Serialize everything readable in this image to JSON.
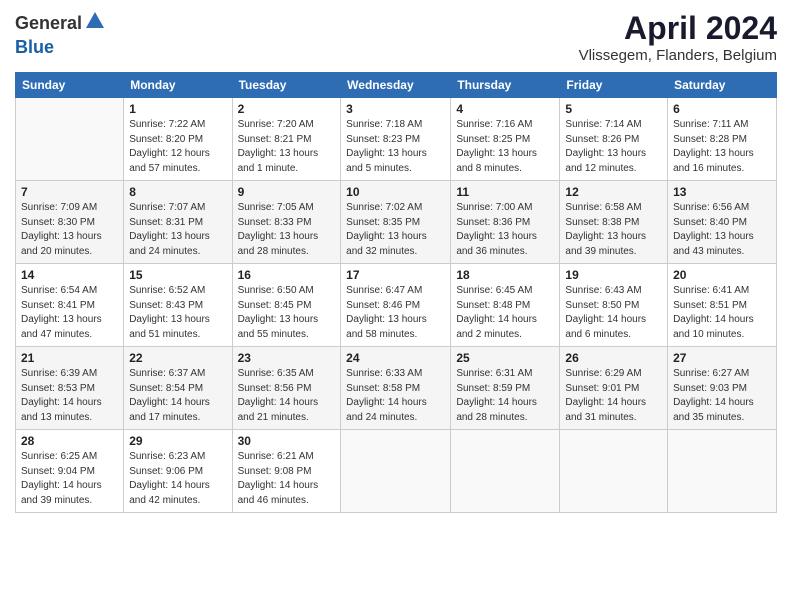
{
  "logo": {
    "general": "General",
    "blue": "Blue"
  },
  "title": "April 2024",
  "location": "Vlissegem, Flanders, Belgium",
  "days_header": [
    "Sunday",
    "Monday",
    "Tuesday",
    "Wednesday",
    "Thursday",
    "Friday",
    "Saturday"
  ],
  "weeks": [
    [
      {
        "num": "",
        "info": ""
      },
      {
        "num": "1",
        "info": "Sunrise: 7:22 AM\nSunset: 8:20 PM\nDaylight: 12 hours\nand 57 minutes."
      },
      {
        "num": "2",
        "info": "Sunrise: 7:20 AM\nSunset: 8:21 PM\nDaylight: 13 hours\nand 1 minute."
      },
      {
        "num": "3",
        "info": "Sunrise: 7:18 AM\nSunset: 8:23 PM\nDaylight: 13 hours\nand 5 minutes."
      },
      {
        "num": "4",
        "info": "Sunrise: 7:16 AM\nSunset: 8:25 PM\nDaylight: 13 hours\nand 8 minutes."
      },
      {
        "num": "5",
        "info": "Sunrise: 7:14 AM\nSunset: 8:26 PM\nDaylight: 13 hours\nand 12 minutes."
      },
      {
        "num": "6",
        "info": "Sunrise: 7:11 AM\nSunset: 8:28 PM\nDaylight: 13 hours\nand 16 minutes."
      }
    ],
    [
      {
        "num": "7",
        "info": "Sunrise: 7:09 AM\nSunset: 8:30 PM\nDaylight: 13 hours\nand 20 minutes."
      },
      {
        "num": "8",
        "info": "Sunrise: 7:07 AM\nSunset: 8:31 PM\nDaylight: 13 hours\nand 24 minutes."
      },
      {
        "num": "9",
        "info": "Sunrise: 7:05 AM\nSunset: 8:33 PM\nDaylight: 13 hours\nand 28 minutes."
      },
      {
        "num": "10",
        "info": "Sunrise: 7:02 AM\nSunset: 8:35 PM\nDaylight: 13 hours\nand 32 minutes."
      },
      {
        "num": "11",
        "info": "Sunrise: 7:00 AM\nSunset: 8:36 PM\nDaylight: 13 hours\nand 36 minutes."
      },
      {
        "num": "12",
        "info": "Sunrise: 6:58 AM\nSunset: 8:38 PM\nDaylight: 13 hours\nand 39 minutes."
      },
      {
        "num": "13",
        "info": "Sunrise: 6:56 AM\nSunset: 8:40 PM\nDaylight: 13 hours\nand 43 minutes."
      }
    ],
    [
      {
        "num": "14",
        "info": "Sunrise: 6:54 AM\nSunset: 8:41 PM\nDaylight: 13 hours\nand 47 minutes."
      },
      {
        "num": "15",
        "info": "Sunrise: 6:52 AM\nSunset: 8:43 PM\nDaylight: 13 hours\nand 51 minutes."
      },
      {
        "num": "16",
        "info": "Sunrise: 6:50 AM\nSunset: 8:45 PM\nDaylight: 13 hours\nand 55 minutes."
      },
      {
        "num": "17",
        "info": "Sunrise: 6:47 AM\nSunset: 8:46 PM\nDaylight: 13 hours\nand 58 minutes."
      },
      {
        "num": "18",
        "info": "Sunrise: 6:45 AM\nSunset: 8:48 PM\nDaylight: 14 hours\nand 2 minutes."
      },
      {
        "num": "19",
        "info": "Sunrise: 6:43 AM\nSunset: 8:50 PM\nDaylight: 14 hours\nand 6 minutes."
      },
      {
        "num": "20",
        "info": "Sunrise: 6:41 AM\nSunset: 8:51 PM\nDaylight: 14 hours\nand 10 minutes."
      }
    ],
    [
      {
        "num": "21",
        "info": "Sunrise: 6:39 AM\nSunset: 8:53 PM\nDaylight: 14 hours\nand 13 minutes."
      },
      {
        "num": "22",
        "info": "Sunrise: 6:37 AM\nSunset: 8:54 PM\nDaylight: 14 hours\nand 17 minutes."
      },
      {
        "num": "23",
        "info": "Sunrise: 6:35 AM\nSunset: 8:56 PM\nDaylight: 14 hours\nand 21 minutes."
      },
      {
        "num": "24",
        "info": "Sunrise: 6:33 AM\nSunset: 8:58 PM\nDaylight: 14 hours\nand 24 minutes."
      },
      {
        "num": "25",
        "info": "Sunrise: 6:31 AM\nSunset: 8:59 PM\nDaylight: 14 hours\nand 28 minutes."
      },
      {
        "num": "26",
        "info": "Sunrise: 6:29 AM\nSunset: 9:01 PM\nDaylight: 14 hours\nand 31 minutes."
      },
      {
        "num": "27",
        "info": "Sunrise: 6:27 AM\nSunset: 9:03 PM\nDaylight: 14 hours\nand 35 minutes."
      }
    ],
    [
      {
        "num": "28",
        "info": "Sunrise: 6:25 AM\nSunset: 9:04 PM\nDaylight: 14 hours\nand 39 minutes."
      },
      {
        "num": "29",
        "info": "Sunrise: 6:23 AM\nSunset: 9:06 PM\nDaylight: 14 hours\nand 42 minutes."
      },
      {
        "num": "30",
        "info": "Sunrise: 6:21 AM\nSunset: 9:08 PM\nDaylight: 14 hours\nand 46 minutes."
      },
      {
        "num": "",
        "info": ""
      },
      {
        "num": "",
        "info": ""
      },
      {
        "num": "",
        "info": ""
      },
      {
        "num": "",
        "info": ""
      }
    ]
  ]
}
